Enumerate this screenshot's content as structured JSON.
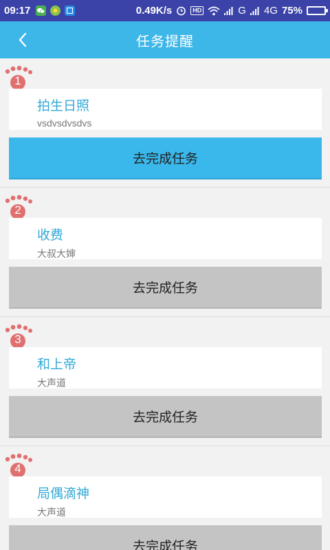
{
  "status_bar": {
    "time": "09:17",
    "speed": "0.49K/s",
    "hd": "HD",
    "network_g": "G",
    "network_4g": "4G",
    "battery": "75%",
    "battery_level": 0.75
  },
  "navbar": {
    "title": "任务提醒"
  },
  "tasks": [
    {
      "num": "1",
      "title": "拍生日照",
      "subtitle": "vsdvsdvsdvs",
      "button": "去完成任务",
      "active": true
    },
    {
      "num": "2",
      "title": "收费",
      "subtitle": "大叔大婶",
      "button": "去完成任务",
      "active": false
    },
    {
      "num": "3",
      "title": "和上帝",
      "subtitle": "大声道",
      "button": "去完成任务",
      "active": false
    },
    {
      "num": "4",
      "title": "局偶滴神",
      "subtitle": "大声道",
      "button": "去完成任务",
      "active": false
    }
  ],
  "colors": {
    "status_bar": "#3b43a8",
    "navbar": "#3db6e8",
    "title_text": "#33a9d6",
    "active_button": "#3ab8ec",
    "inactive_button": "#c4c4c4",
    "footprint": "#e07070"
  },
  "icons": {
    "back": "chevron-left-icon",
    "footprint": "footprint-icon"
  }
}
